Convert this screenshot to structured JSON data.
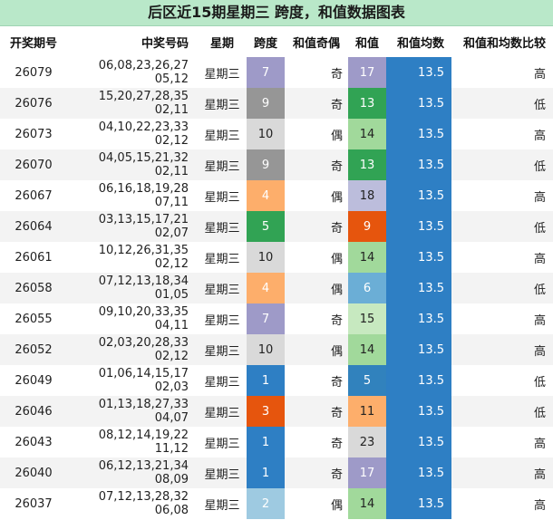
{
  "title": "后区近15期星期三  跨度，和值数据图表",
  "headers": [
    "开奖期号",
    "中奖号码",
    "星期",
    "跨度",
    "和值奇偶",
    "和值",
    "和值均数",
    "和值和均数比较"
  ],
  "colors": {
    "title_bg": "#b9e8c9",
    "avg_bg": "#2e7fc4",
    "span_scale": {
      "1": "#2e7fc4",
      "2": "#9ecae1",
      "3": "#e6550d",
      "4": "#fdae6b",
      "5": "#31a354",
      "7": "#9e9ac8",
      "9": "#969696",
      "10": "#d9d9d9"
    },
    "sum_scale": {
      "5": "#3182bd",
      "6": "#6baed6",
      "9": "#e6550d",
      "11": "#fdae6b",
      "13": "#31a354",
      "14": "#a1d99b",
      "15": "#c7e9c0",
      "17": "#9e9ac8",
      "18": "#bcbddc",
      "23": "#d9d9d9"
    }
  },
  "rows": [
    {
      "issue": "26079",
      "numbers": "06,08,23,26,27 05,12",
      "weekday": "星期三",
      "span": "7",
      "odd_even": "奇",
      "sum": "17",
      "avg": "13.5",
      "cmp": "高"
    },
    {
      "issue": "26076",
      "numbers": "15,20,27,28,35 02,11",
      "weekday": "星期三",
      "span": "9",
      "odd_even": "奇",
      "sum": "13",
      "avg": "13.5",
      "cmp": "低"
    },
    {
      "issue": "26073",
      "numbers": "04,10,22,23,33 02,12",
      "weekday": "星期三",
      "span": "10",
      "odd_even": "偶",
      "sum": "14",
      "avg": "13.5",
      "cmp": "高"
    },
    {
      "issue": "26070",
      "numbers": "04,05,15,21,32 02,11",
      "weekday": "星期三",
      "span": "9",
      "odd_even": "奇",
      "sum": "13",
      "avg": "13.5",
      "cmp": "低"
    },
    {
      "issue": "26067",
      "numbers": "06,16,18,19,28 07,11",
      "weekday": "星期三",
      "span": "4",
      "odd_even": "偶",
      "sum": "18",
      "avg": "13.5",
      "cmp": "高"
    },
    {
      "issue": "26064",
      "numbers": "03,13,15,17,21 02,07",
      "weekday": "星期三",
      "span": "5",
      "odd_even": "奇",
      "sum": "9",
      "avg": "13.5",
      "cmp": "低"
    },
    {
      "issue": "26061",
      "numbers": "10,12,26,31,35 02,12",
      "weekday": "星期三",
      "span": "10",
      "odd_even": "偶",
      "sum": "14",
      "avg": "13.5",
      "cmp": "高"
    },
    {
      "issue": "26058",
      "numbers": "07,12,13,18,34 01,05",
      "weekday": "星期三",
      "span": "4",
      "odd_even": "偶",
      "sum": "6",
      "avg": "13.5",
      "cmp": "低"
    },
    {
      "issue": "26055",
      "numbers": "09,10,20,33,35 04,11",
      "weekday": "星期三",
      "span": "7",
      "odd_even": "奇",
      "sum": "15",
      "avg": "13.5",
      "cmp": "高"
    },
    {
      "issue": "26052",
      "numbers": "02,03,20,28,33 02,12",
      "weekday": "星期三",
      "span": "10",
      "odd_even": "偶",
      "sum": "14",
      "avg": "13.5",
      "cmp": "高"
    },
    {
      "issue": "26049",
      "numbers": "01,06,14,15,17 02,03",
      "weekday": "星期三",
      "span": "1",
      "odd_even": "奇",
      "sum": "5",
      "avg": "13.5",
      "cmp": "低"
    },
    {
      "issue": "26046",
      "numbers": "01,13,18,27,33 04,07",
      "weekday": "星期三",
      "span": "3",
      "odd_even": "奇",
      "sum": "11",
      "avg": "13.5",
      "cmp": "低"
    },
    {
      "issue": "26043",
      "numbers": "08,12,14,19,22 11,12",
      "weekday": "星期三",
      "span": "1",
      "odd_even": "奇",
      "sum": "23",
      "avg": "13.5",
      "cmp": "高"
    },
    {
      "issue": "26040",
      "numbers": "06,12,13,21,34 08,09",
      "weekday": "星期三",
      "span": "1",
      "odd_even": "奇",
      "sum": "17",
      "avg": "13.5",
      "cmp": "高"
    },
    {
      "issue": "26037",
      "numbers": "07,12,13,28,32 06,08",
      "weekday": "星期三",
      "span": "2",
      "odd_even": "偶",
      "sum": "14",
      "avg": "13.5",
      "cmp": "高"
    }
  ]
}
